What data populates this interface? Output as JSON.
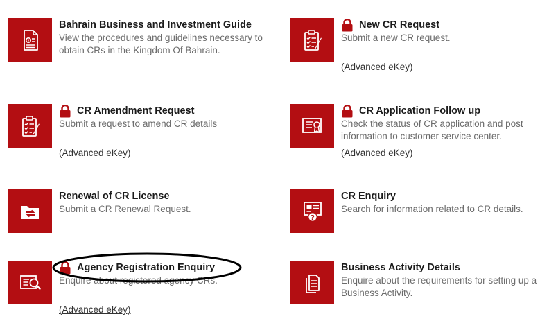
{
  "services": [
    {
      "title": "Bahrain Business and Investment Guide",
      "description": "View the procedures and guidelines necessary to obtain CRs in the Kingdom Of Bahrain.",
      "locked": false,
      "ekey": null,
      "icon": "document-icon"
    },
    {
      "title": "New CR Request",
      "description": "Submit a new CR request.",
      "locked": true,
      "ekey": "(Advanced eKey)",
      "icon": "clipboard-pen-icon"
    },
    {
      "title": "CR Amendment Request",
      "description": "Submit a request to amend CR details",
      "locked": true,
      "ekey": "(Advanced eKey)",
      "icon": "clipboard-pen-icon"
    },
    {
      "title": "CR Application Follow up",
      "description": "Check the status of CR application and post information to customer service center.",
      "locked": true,
      "ekey": "(Advanced eKey)",
      "icon": "certificate-icon"
    },
    {
      "title": "Renewal of CR License",
      "description": "Submit a CR Renewal Request.",
      "locked": false,
      "ekey": null,
      "icon": "folder-renew-icon"
    },
    {
      "title": "CR Enquiry",
      "description": "Search for information related to CR details.",
      "locked": false,
      "ekey": null,
      "icon": "document-question-icon"
    },
    {
      "title": "Agency Registration Enquiry",
      "description": "Enquire about registered agency CRs.",
      "locked": true,
      "ekey": "(Advanced eKey)",
      "icon": "certificate-search-icon"
    },
    {
      "title": "Business Activity Details",
      "description": "Enquire about the requirements for setting up a Business Activity.",
      "locked": false,
      "ekey": null,
      "icon": "documents-icon"
    }
  ],
  "colors": {
    "accent": "#b30e12",
    "title": "#1b1b1b",
    "description": "#6b6b6b"
  }
}
